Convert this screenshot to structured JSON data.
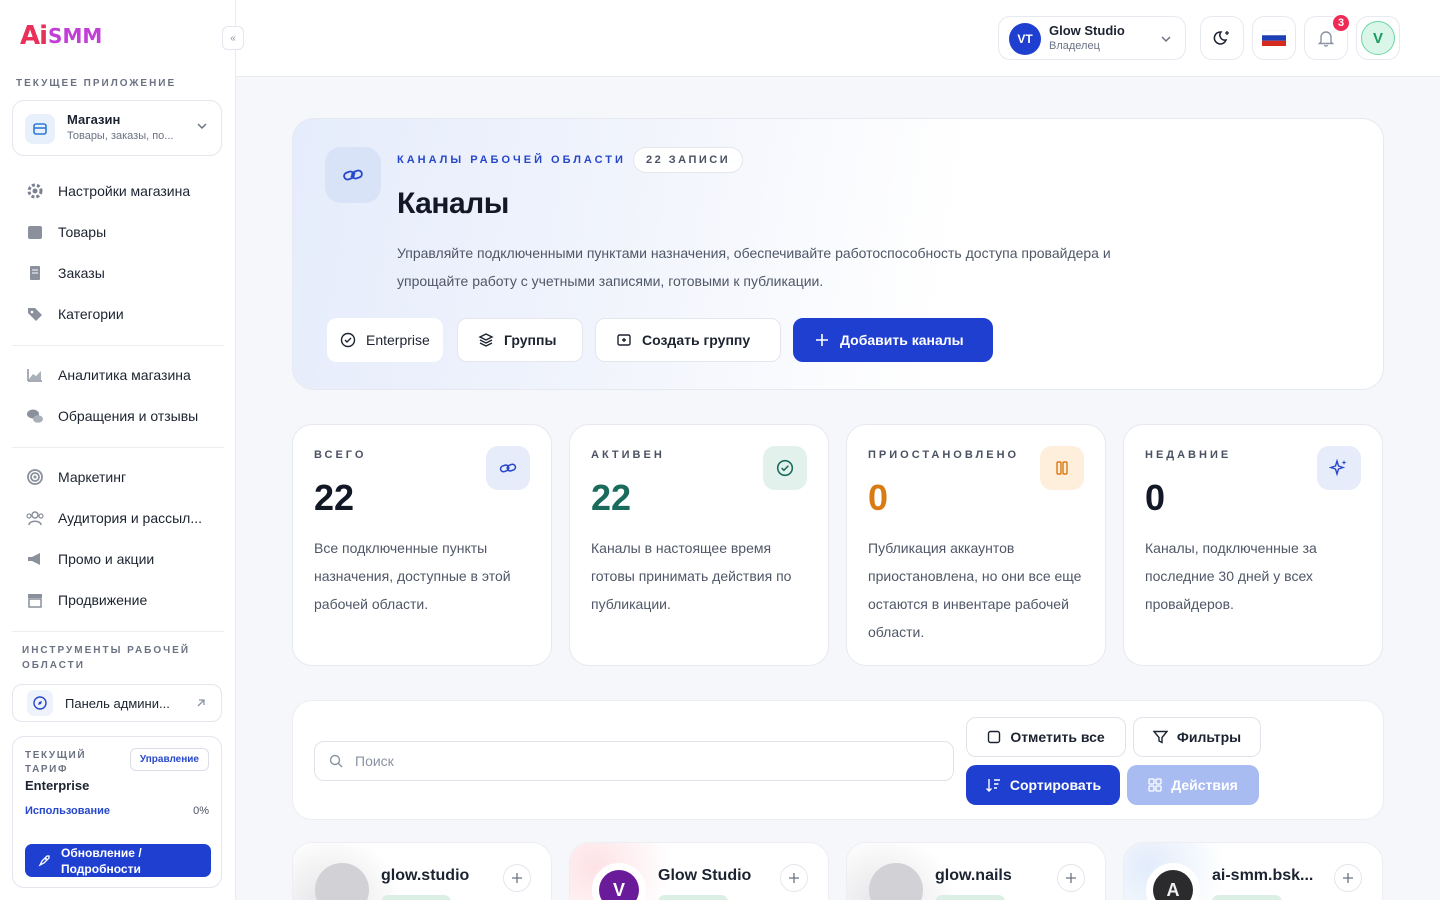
{
  "sidebar": {
    "logo_ai": "Ai",
    "logo_smm": "SMM",
    "collapse_label": "«",
    "current_app_title": "ТЕКУЩЕЕ ПРИЛОЖЕНИЕ",
    "current_app": {
      "name": "Магазин",
      "subtitle": "Товары, заказы, по..."
    },
    "items": [
      {
        "label": "Настройки магазина",
        "icon": "gear-icon"
      },
      {
        "label": "Товары",
        "icon": "box-icon"
      },
      {
        "label": "Заказы",
        "icon": "receipt-icon"
      },
      {
        "label": "Категории",
        "icon": "tag-icon"
      },
      {
        "label": "Аналитика магазина",
        "icon": "chart-icon"
      },
      {
        "label": "Обращения и отзывы",
        "icon": "chat-icon"
      },
      {
        "label": "Маркетинг",
        "icon": "target-icon"
      },
      {
        "label": "Аудитория и рассыл...",
        "icon": "users-icon"
      },
      {
        "label": "Промо и акции",
        "icon": "megaphone-icon"
      },
      {
        "label": "Продвижение",
        "icon": "storefront-icon"
      }
    ],
    "tools_title": "ИНСТРУМЕНТЫ РАБОЧЕЙ ОБЛАСТИ",
    "admin_panel": "Панель админи...",
    "plan": {
      "title": "ТЕКУЩИЙ ТАРИФ",
      "name": "Enterprise",
      "manage": "Управление",
      "usage_label": "Использование",
      "usage_value": "0%",
      "upgrade": "Обновление / Подробности"
    }
  },
  "topbar": {
    "workspace_initials": "VT",
    "workspace_name": "Glow Studio",
    "workspace_role": "Владелец",
    "notifications_count": "3",
    "user_initial": "V"
  },
  "hero": {
    "eyebrow": "КАНАЛЫ РАБОЧЕЙ ОБЛАСТИ",
    "count_chip": "22 ЗАПИСИ",
    "title": "Каналы",
    "description": "Управляйте подключенными пунктами назначения, обеспечивайте работоспособность доступа провайдера и упрощайте работу с учетными записями, готовыми к публикации.",
    "btn_plan": "Enterprise",
    "btn_groups": "Группы",
    "btn_create_group": "Создать группу",
    "btn_add_channels": "Добавить каналы"
  },
  "stats": [
    {
      "label": "ВСЕГО",
      "value": "22",
      "text": "Все подключенные пункты назначения, доступные в этой рабочей области.",
      "color": "#121826",
      "icon": "link-icon"
    },
    {
      "label": "АКТИВЕН",
      "value": "22",
      "text": "Каналы в настоящее время готовы принимать действия по публикации.",
      "color": "#1a6b5c",
      "icon": "check-circle-icon"
    },
    {
      "label": "ПРИОСТАНОВЛЕНО",
      "value": "0",
      "text": "Публикация аккаунтов приостановлена, но они все еще остаются в инвентаре рабочей области.",
      "color": "#d97a12",
      "icon": "pause-icon"
    },
    {
      "label": "НЕДАВНИЕ",
      "value": "0",
      "text": "Каналы, подключенные за последние 30 дней у всех провайдеров.",
      "color": "#121826",
      "icon": "sparkle-icon"
    }
  ],
  "toolbar": {
    "search_placeholder": "Поиск",
    "select_all": "Отметить все",
    "filters": "Фильтры",
    "sort": "Сортировать",
    "actions": "Действия"
  },
  "channels": [
    {
      "name": "glow.studio",
      "avatar": ""
    },
    {
      "name": "Glow Studio",
      "avatar": "V"
    },
    {
      "name": "glow.nails",
      "avatar": ""
    },
    {
      "name": "ai-smm.bsk...",
      "avatar": "A"
    }
  ],
  "colors": {
    "accent": "#1f3fd1",
    "badge": "#ef2a55",
    "active": "#1a6b5c",
    "paused": "#d97a12"
  }
}
